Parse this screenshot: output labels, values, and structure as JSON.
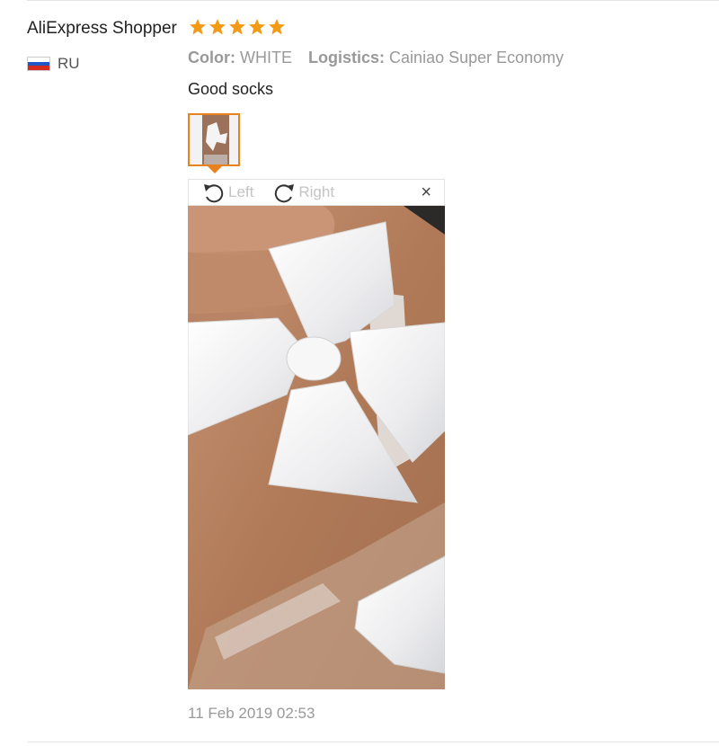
{
  "review": {
    "user_name": "AliExpress Shopper",
    "rating": 5,
    "country_code": "RU",
    "flag_colors": [
      "#ffffff",
      "#1f56c8",
      "#d52b1e"
    ],
    "star_color": "#f39a17",
    "attributes": [
      {
        "key": "Color:",
        "value": "WHITE"
      },
      {
        "key": "Logistics:",
        "value": "Cainiao Super Economy"
      }
    ],
    "text": "Good socks",
    "timestamp": "11 Feb 2019 02:53"
  },
  "viewer": {
    "rotate_left_label": "Left",
    "rotate_right_label": "Right",
    "close_label": "×",
    "accent_color": "#e8811e"
  }
}
